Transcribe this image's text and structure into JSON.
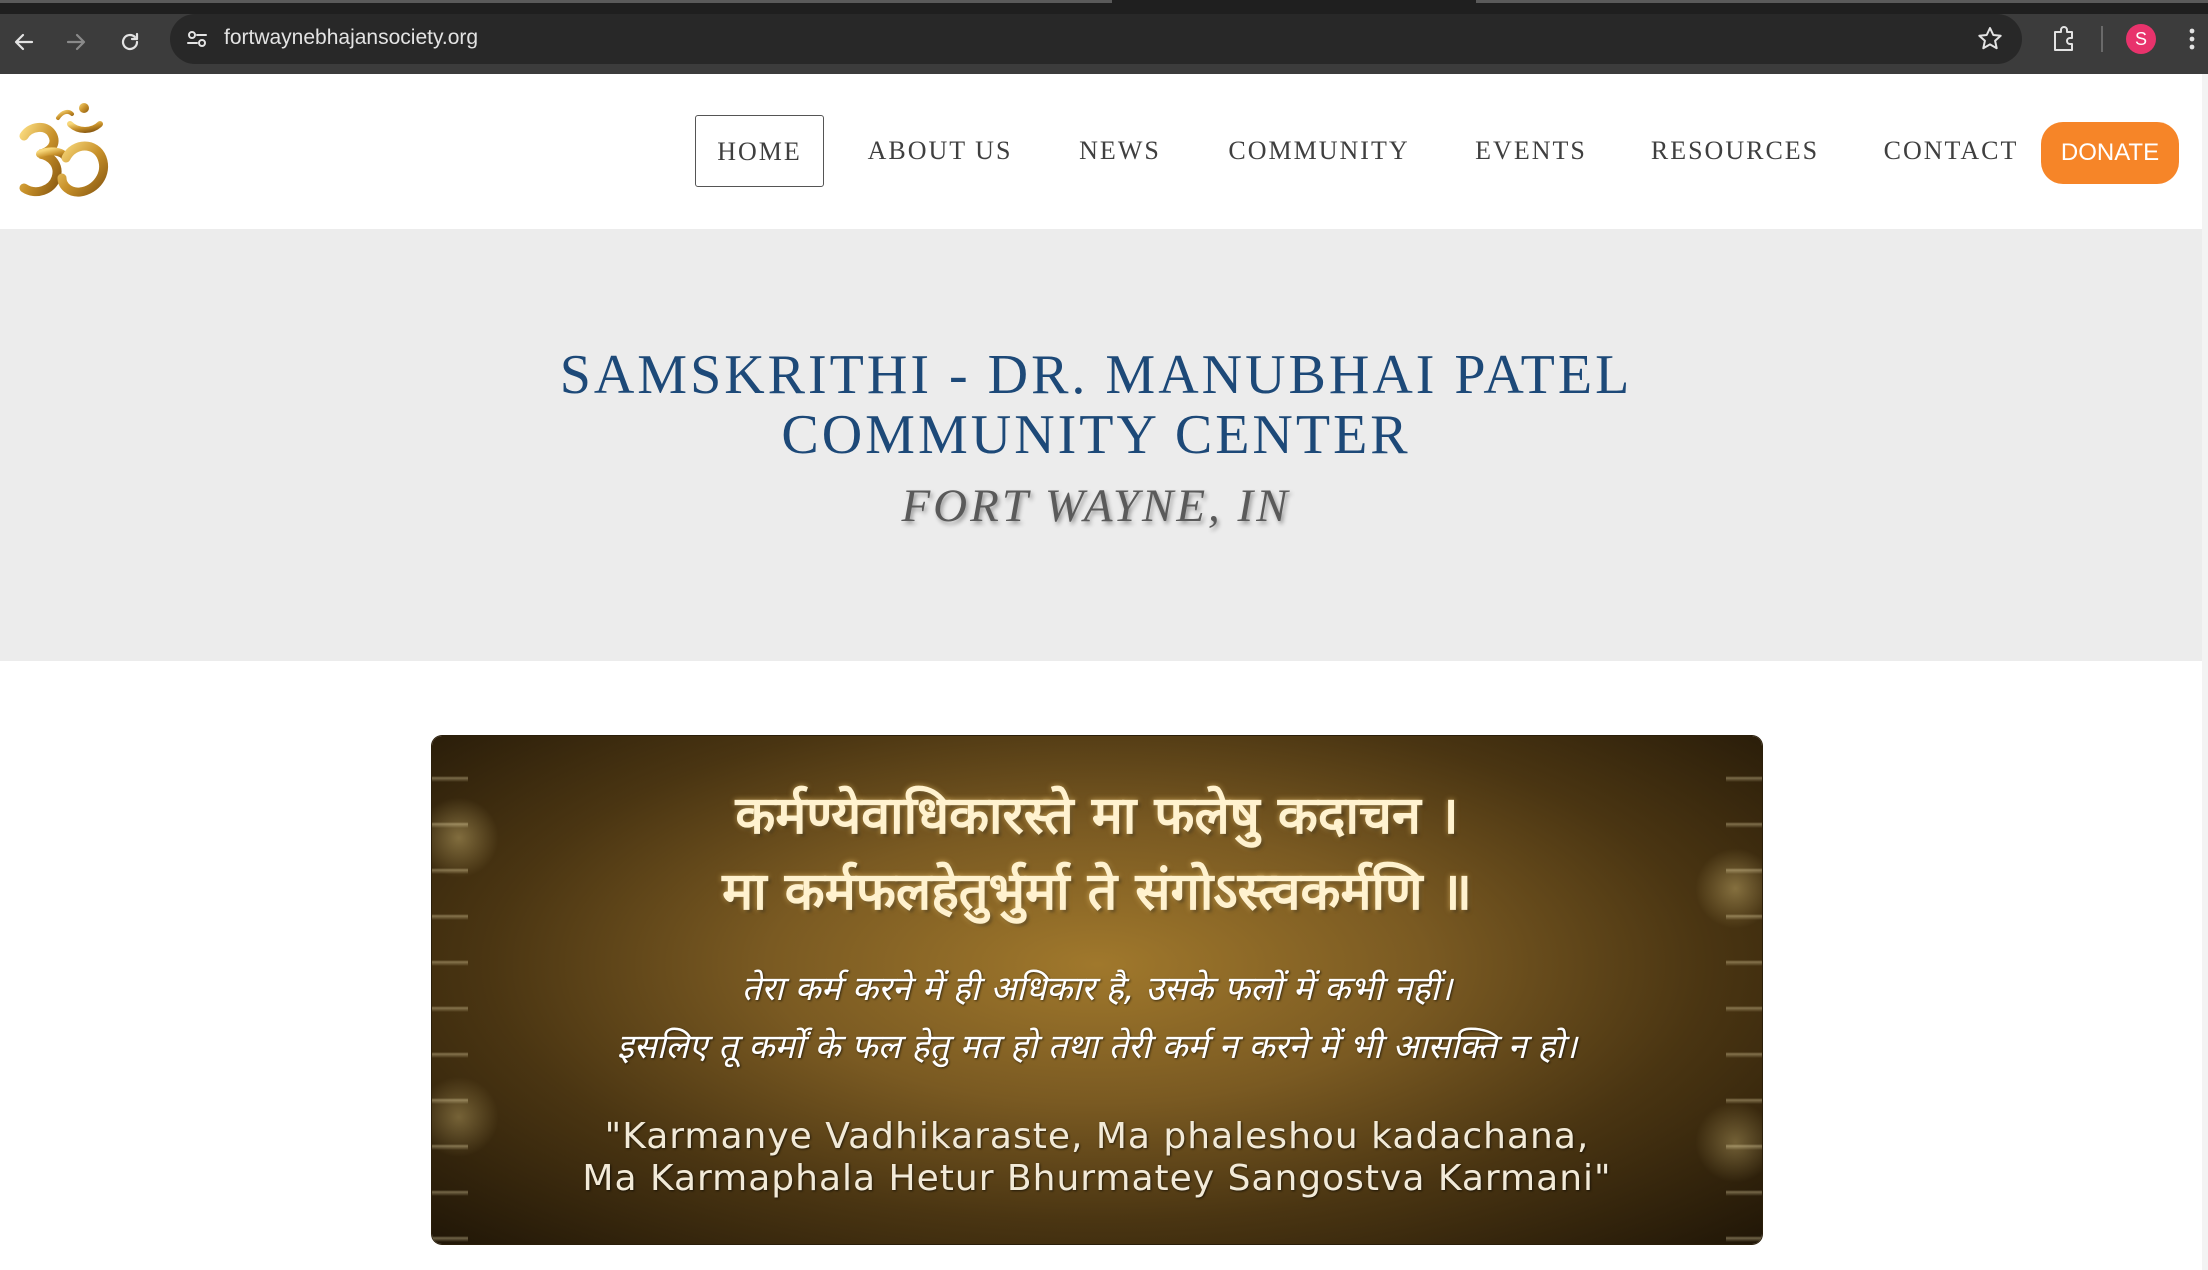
{
  "browser": {
    "url": "fortwaynebhajansociety.org",
    "avatar_initial": "S",
    "icons": {
      "back": "back-arrow-icon",
      "forward": "forward-arrow-icon",
      "reload": "reload-icon",
      "site_info": "site-info-icon",
      "bookmark": "star-icon",
      "extensions": "puzzle-icon",
      "menu": "kebab-menu-icon"
    }
  },
  "site": {
    "logo": "om-symbol-icon",
    "nav": {
      "items": [
        {
          "label": "HOME",
          "active": true
        },
        {
          "label": "ABOUT US",
          "active": false
        },
        {
          "label": "NEWS",
          "active": false
        },
        {
          "label": "COMMUNITY",
          "active": false
        },
        {
          "label": "EVENTS",
          "active": false
        },
        {
          "label": "RESOURCES",
          "active": false
        },
        {
          "label": "CONTACT",
          "active": false
        }
      ],
      "donate_label": "DONATE"
    },
    "colors": {
      "donate": "#f68528",
      "title": "#1d4978",
      "hero_bg": "#ececec"
    }
  },
  "hero": {
    "title_line1": "SAMSKRITHI - DR. MANUBHAI PATEL",
    "title_line2": "COMMUNITY CENTER",
    "subtitle": "FORT WAYNE, IN"
  },
  "banner": {
    "sanskrit_line1": "कर्मण्येवाधिकारस्ते मा फलेषु कदाचन ।",
    "sanskrit_line2": "मा कर्मफलहेतुर्भुर्मा ते संगोऽस्त्वकर्मणि ॥",
    "hindi_line1": "तेरा कर्म करने में ही अधिकार है, उसके फलों में कभी नहीं।",
    "hindi_line2": "इसलिए तू कर्मों के फल हेतु मत हो तथा तेरी कर्म न करने में भी आसक्ति न हो।",
    "translit_line1": "\"Karmanye Vadhikaraste, Ma phaleshou kadachana,",
    "translit_line2": "Ma Karmaphala Hetur Bhurmatey Sangostva Karmani\""
  }
}
